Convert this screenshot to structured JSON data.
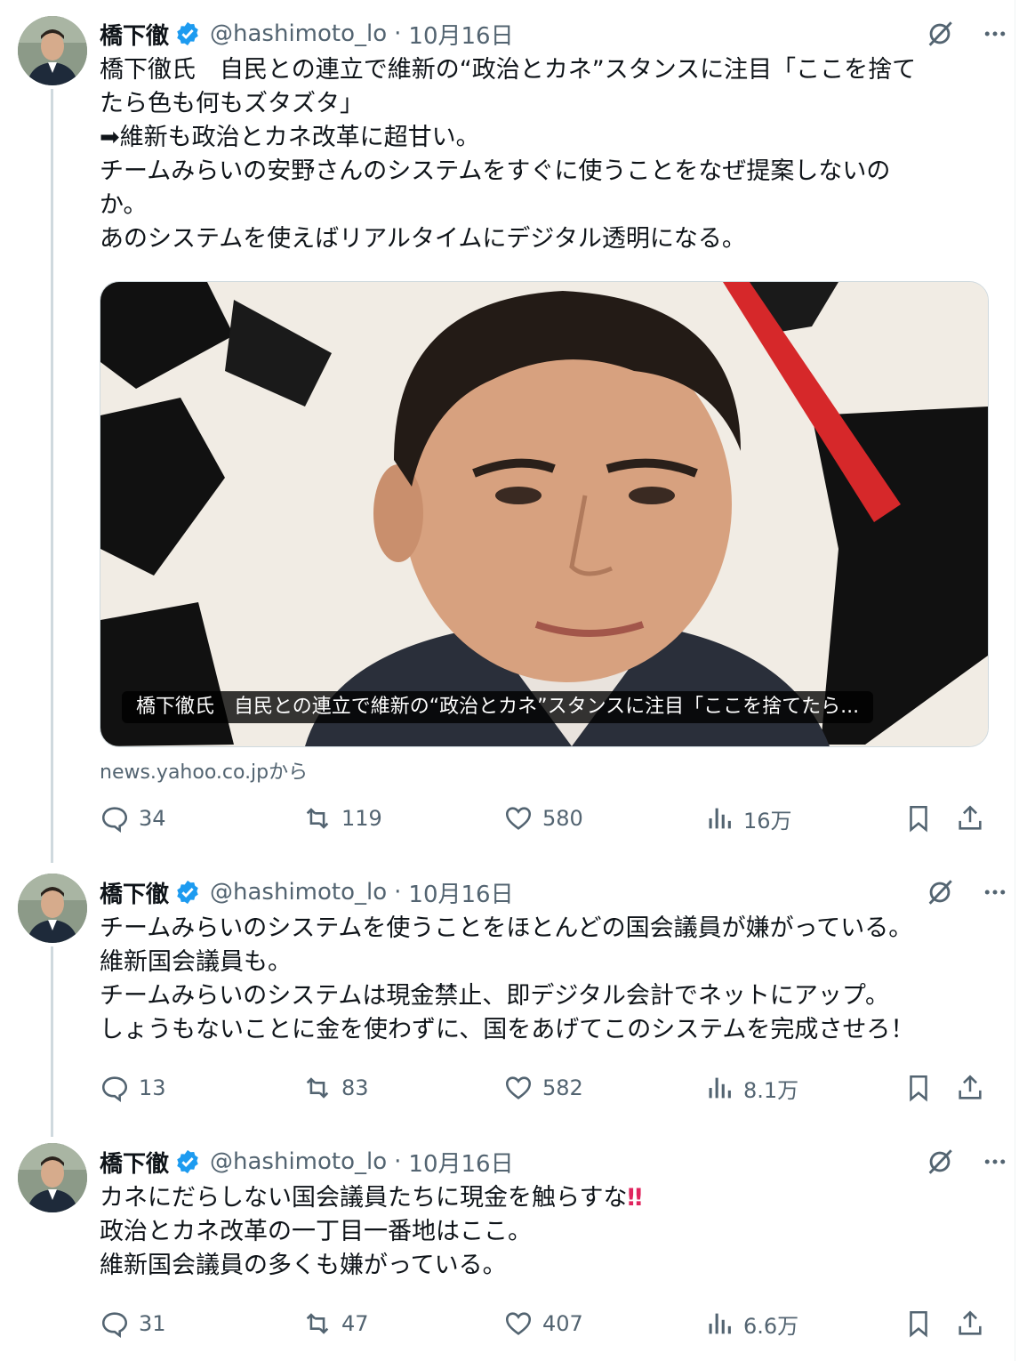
{
  "tweets": [
    {
      "author": {
        "name": "橋下徹",
        "handle": "@hashimoto_lo",
        "verified": true
      },
      "date": "10月16日",
      "lines": [
        "橋下徹氏　自民との連立で維新の“政治とカネ”スタンスに注目「ここを捨て",
        "たら色も何もズタズタ」",
        "➡維新も政治とカネ改革に超甘い。",
        "チームみらいの安野さんのシステムをすぐに使うことをなぜ提案しないの",
        "か。",
        "あのシステムを使えばリアルタイムにデジタル透明になる。"
      ],
      "card": {
        "caption": "橋下徹氏　自民との連立で維新の“政治とカネ”スタンスに注目「ここを捨てたら...",
        "source": "news.yahoo.co.jpから"
      },
      "stats": {
        "replies": "34",
        "reposts": "119",
        "likes": "580",
        "views": "16万"
      }
    },
    {
      "author": {
        "name": "橋下徹",
        "handle": "@hashimoto_lo",
        "verified": true
      },
      "date": "10月16日",
      "lines": [
        "チームみらいのシステムを使うことをほとんどの国会議員が嫌がっている。",
        "維新国会議員も。",
        "チームみらいのシステムは現金禁止、即デジタル会計でネットにアップ。",
        "しょうもないことに金を使わずに、国をあげてこのシステムを完成させろ！"
      ],
      "stats": {
        "replies": "13",
        "reposts": "83",
        "likes": "582",
        "views": "8.1万"
      }
    },
    {
      "author": {
        "name": "橋下徹",
        "handle": "@hashimoto_lo",
        "verified": true
      },
      "date": "10月16日",
      "lines": [
        "カネにだらしない国会議員たちに現金を触らすな",
        "政治とカネ改革の一丁目一番地はここ。",
        "維新国会議員の多くも嫌がっている。"
      ],
      "emphasis": "‼",
      "stats": {
        "replies": "31",
        "reposts": "47",
        "likes": "407",
        "views": "6.6万"
      }
    }
  ],
  "colors": {
    "text": "#0f1419",
    "secondary": "#536471",
    "verified": "#1d9bf0",
    "thread": "#cfd9de",
    "emphasis": "#e0245e"
  },
  "icons": [
    "verified-badge-icon",
    "grok-slash-icon",
    "more-icon",
    "reply-icon",
    "repost-icon",
    "like-icon",
    "views-icon",
    "bookmark-icon",
    "share-icon"
  ]
}
